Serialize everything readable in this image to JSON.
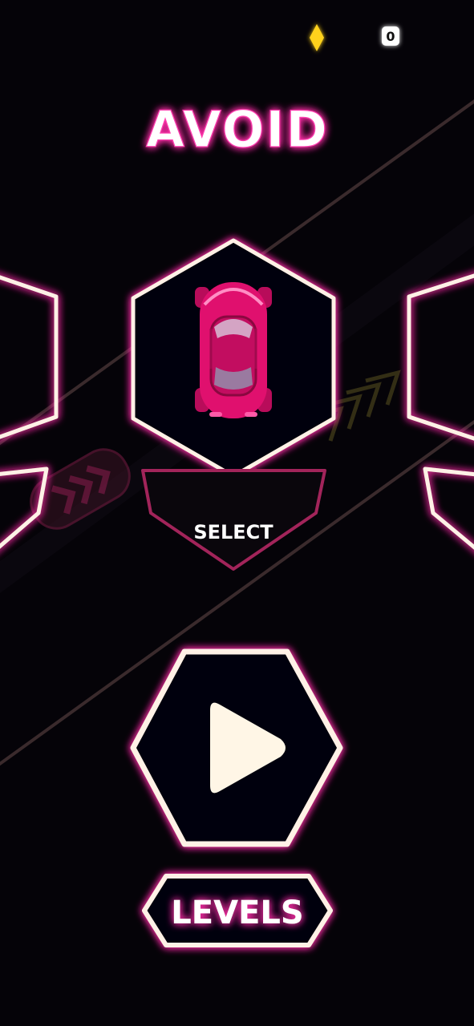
{
  "hud": {
    "gems_icon": "diamond-icon",
    "gem_count": "0",
    "gem_color": "#ffd21e"
  },
  "title": "AVOID",
  "car_select": {
    "select_label": "SELECT",
    "selected_car_color": "#e0106e",
    "frame_color": "#fff1e6",
    "accent_color": "#ff3fb0"
  },
  "play_button": {
    "icon": "play-icon"
  },
  "levels_button": {
    "label": "LEVELS"
  }
}
